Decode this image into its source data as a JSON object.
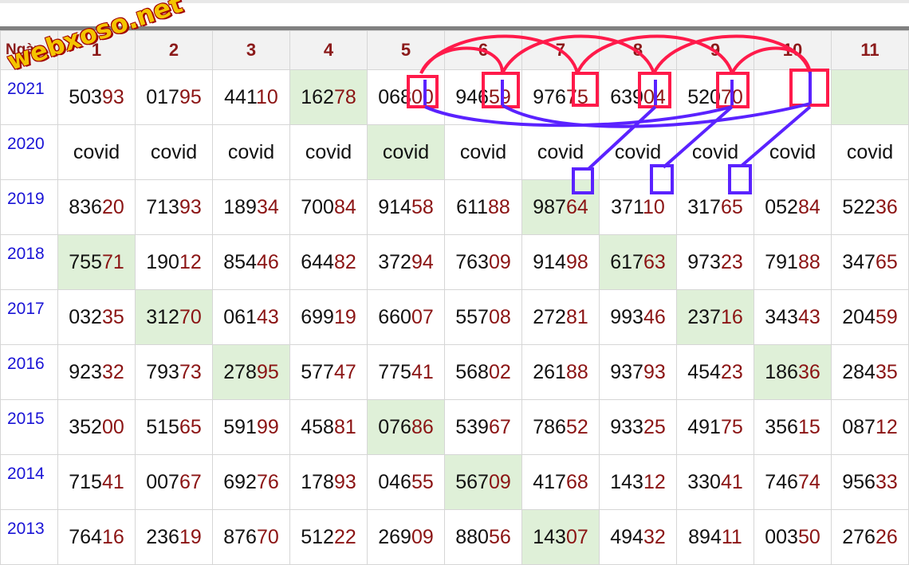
{
  "header": {
    "corner_label": "Ngày",
    "columns": [
      "1",
      "2",
      "3",
      "4",
      "5",
      "6",
      "7",
      "8",
      "9",
      "10",
      "11"
    ]
  },
  "rows": [
    {
      "year": "2021",
      "cells": [
        {
          "head": "503",
          "tail": "93"
        },
        {
          "head": "017",
          "tail": "95"
        },
        {
          "head": "441",
          "tail": "10"
        },
        {
          "head": "162",
          "tail": "78"
        },
        {
          "head": "068",
          "tail": "00"
        },
        {
          "head": "946",
          "tail": "59"
        },
        {
          "head": "976",
          "tail": "75"
        },
        {
          "head": "639",
          "tail": "04"
        },
        {
          "head": "520",
          "tail": "70"
        },
        {
          "head": "",
          "tail": ""
        },
        {
          "head": "",
          "tail": ""
        }
      ]
    },
    {
      "year": "2020",
      "cells": [
        {
          "head": "covid",
          "tail": ""
        },
        {
          "head": "covid",
          "tail": ""
        },
        {
          "head": "covid",
          "tail": ""
        },
        {
          "head": "covid",
          "tail": ""
        },
        {
          "head": "covid",
          "tail": ""
        },
        {
          "head": "covid",
          "tail": ""
        },
        {
          "head": "covid",
          "tail": ""
        },
        {
          "head": "covid",
          "tail": ""
        },
        {
          "head": "covid",
          "tail": ""
        },
        {
          "head": "covid",
          "tail": ""
        },
        {
          "head": "covid",
          "tail": ""
        }
      ]
    },
    {
      "year": "2019",
      "cells": [
        {
          "head": "836",
          "tail": "20"
        },
        {
          "head": "713",
          "tail": "93"
        },
        {
          "head": "189",
          "tail": "34"
        },
        {
          "head": "700",
          "tail": "84"
        },
        {
          "head": "914",
          "tail": "58"
        },
        {
          "head": "611",
          "tail": "88"
        },
        {
          "head": "987",
          "tail": "64"
        },
        {
          "head": "371",
          "tail": "10"
        },
        {
          "head": "317",
          "tail": "65"
        },
        {
          "head": "052",
          "tail": "84"
        },
        {
          "head": "522",
          "tail": "36"
        }
      ]
    },
    {
      "year": "2018",
      "cells": [
        {
          "head": "755",
          "tail": "71"
        },
        {
          "head": "190",
          "tail": "12"
        },
        {
          "head": "854",
          "tail": "46"
        },
        {
          "head": "644",
          "tail": "82"
        },
        {
          "head": "372",
          "tail": "94"
        },
        {
          "head": "763",
          "tail": "09"
        },
        {
          "head": "914",
          "tail": "98"
        },
        {
          "head": "617",
          "tail": "63"
        },
        {
          "head": "973",
          "tail": "23"
        },
        {
          "head": "791",
          "tail": "88"
        },
        {
          "head": "347",
          "tail": "65"
        }
      ]
    },
    {
      "year": "2017",
      "cells": [
        {
          "head": "032",
          "tail": "35"
        },
        {
          "head": "312",
          "tail": "70"
        },
        {
          "head": "061",
          "tail": "43"
        },
        {
          "head": "699",
          "tail": "19"
        },
        {
          "head": "660",
          "tail": "07"
        },
        {
          "head": "557",
          "tail": "08"
        },
        {
          "head": "272",
          "tail": "81"
        },
        {
          "head": "993",
          "tail": "46"
        },
        {
          "head": "237",
          "tail": "16"
        },
        {
          "head": "343",
          "tail": "43"
        },
        {
          "head": "204",
          "tail": "59"
        }
      ]
    },
    {
      "year": "2016",
      "cells": [
        {
          "head": "923",
          "tail": "32"
        },
        {
          "head": "793",
          "tail": "73"
        },
        {
          "head": "278",
          "tail": "95"
        },
        {
          "head": "577",
          "tail": "47"
        },
        {
          "head": "775",
          "tail": "41"
        },
        {
          "head": "568",
          "tail": "02"
        },
        {
          "head": "261",
          "tail": "88"
        },
        {
          "head": "937",
          "tail": "93"
        },
        {
          "head": "454",
          "tail": "23"
        },
        {
          "head": "186",
          "tail": "36"
        },
        {
          "head": "284",
          "tail": "35"
        }
      ]
    },
    {
      "year": "2015",
      "cells": [
        {
          "head": "352",
          "tail": "00"
        },
        {
          "head": "515",
          "tail": "65"
        },
        {
          "head": "591",
          "tail": "99"
        },
        {
          "head": "458",
          "tail": "81"
        },
        {
          "head": "076",
          "tail": "86"
        },
        {
          "head": "539",
          "tail": "67"
        },
        {
          "head": "786",
          "tail": "52"
        },
        {
          "head": "933",
          "tail": "25"
        },
        {
          "head": "491",
          "tail": "75"
        },
        {
          "head": "356",
          "tail": "15"
        },
        {
          "head": "087",
          "tail": "12"
        }
      ]
    },
    {
      "year": "2014",
      "cells": [
        {
          "head": "715",
          "tail": "41"
        },
        {
          "head": "007",
          "tail": "67"
        },
        {
          "head": "692",
          "tail": "76"
        },
        {
          "head": "178",
          "tail": "93"
        },
        {
          "head": "046",
          "tail": "55"
        },
        {
          "head": "567",
          "tail": "09"
        },
        {
          "head": "417",
          "tail": "68"
        },
        {
          "head": "143",
          "tail": "12"
        },
        {
          "head": "330",
          "tail": "41"
        },
        {
          "head": "746",
          "tail": "74"
        },
        {
          "head": "956",
          "tail": "33"
        }
      ]
    },
    {
      "year": "2013",
      "cells": [
        {
          "head": "764",
          "tail": "16"
        },
        {
          "head": "236",
          "tail": "19"
        },
        {
          "head": "876",
          "tail": "70"
        },
        {
          "head": "512",
          "tail": "22"
        },
        {
          "head": "269",
          "tail": "09"
        },
        {
          "head": "880",
          "tail": "56"
        },
        {
          "head": "143",
          "tail": "07"
        },
        {
          "head": "494",
          "tail": "32"
        },
        {
          "head": "894",
          "tail": "11"
        },
        {
          "head": "003",
          "tail": "50"
        },
        {
          "head": "276",
          "tail": "26"
        }
      ]
    }
  ],
  "highlights": [
    [
      0,
      3
    ],
    [
      0,
      10
    ],
    [
      1,
      4
    ],
    [
      2,
      6
    ],
    [
      3,
      0
    ],
    [
      3,
      7
    ],
    [
      4,
      1
    ],
    [
      4,
      8
    ],
    [
      5,
      2
    ],
    [
      5,
      9
    ],
    [
      6,
      4
    ],
    [
      7,
      5
    ],
    [
      8,
      6
    ]
  ],
  "watermark": "webxoso.net",
  "colors": {
    "arc_red": "#ff1a4a",
    "arc_blue": "#5a22ff",
    "highlight": "#dff0d8",
    "year": "#1a14d6",
    "tail": "#8b1414"
  }
}
